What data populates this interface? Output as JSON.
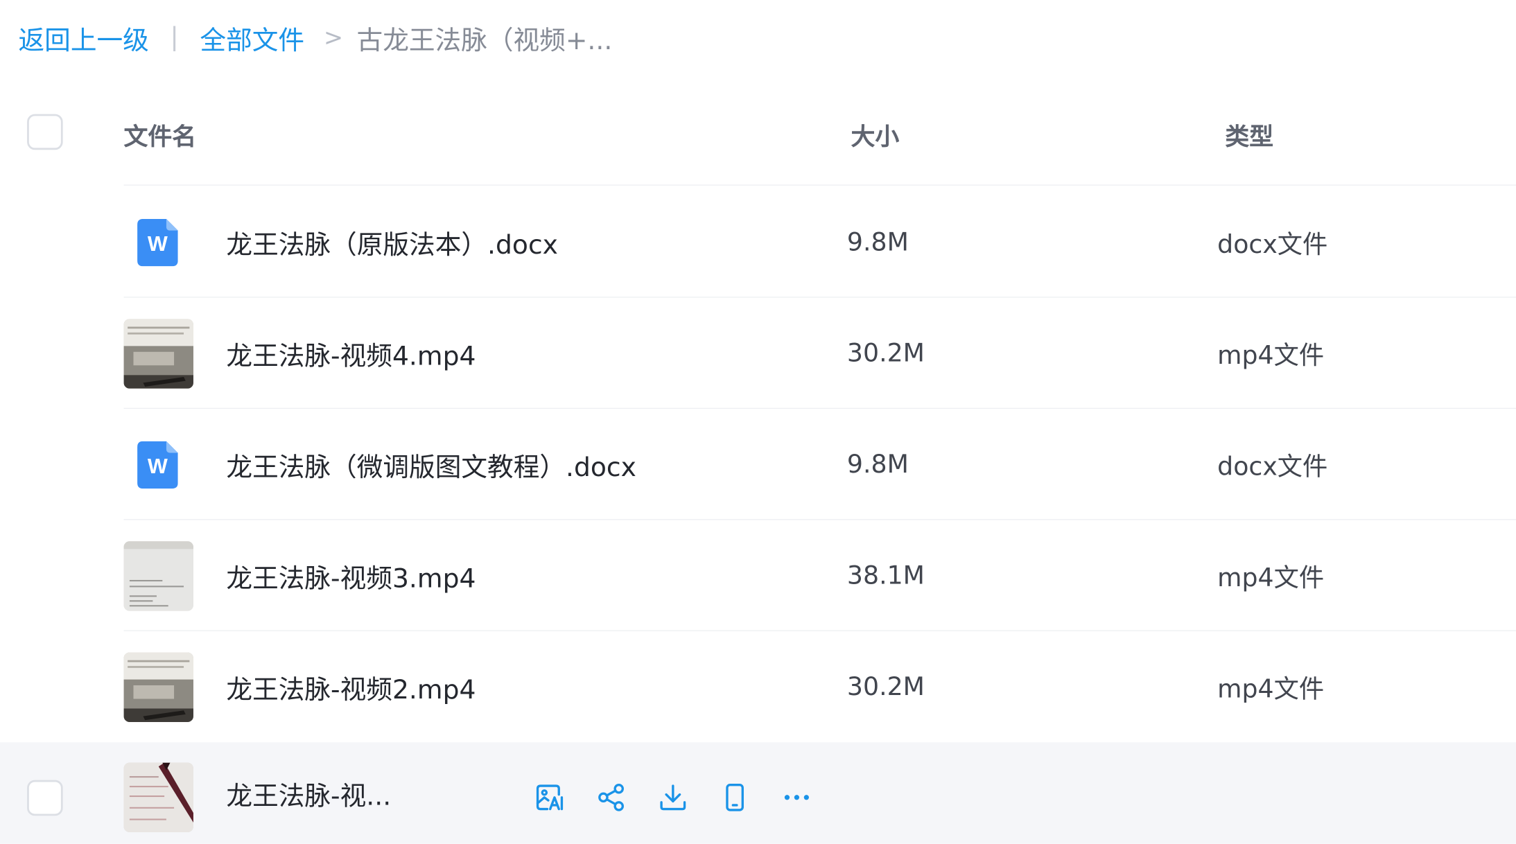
{
  "breadcrumb": {
    "back": "返回上一级",
    "separator": "|",
    "all_files": "全部文件",
    "arrow": ">",
    "current": "古龙王法脉（视频+..."
  },
  "columns": {
    "name": "文件名",
    "size": "大小",
    "type": "类型"
  },
  "files": [
    {
      "name": "龙王法脉（原版法本）.docx",
      "size": "9.8M",
      "type": "docx文件",
      "icon": "word-doc-icon"
    },
    {
      "name": "龙王法脉-视频4.mp4",
      "size": "30.2M",
      "type": "mp4文件",
      "icon": "video-thumbnail"
    },
    {
      "name": "龙王法脉（微调版图文教程）.docx",
      "size": "9.8M",
      "type": "docx文件",
      "icon": "word-doc-icon"
    },
    {
      "name": "龙王法脉-视频3.mp4",
      "size": "38.1M",
      "type": "mp4文件",
      "icon": "video-thumbnail"
    },
    {
      "name": "龙王法脉-视频2.mp4",
      "size": "30.2M",
      "type": "mp4文件",
      "icon": "video-thumbnail"
    },
    {
      "name": "龙王法脉-视...",
      "icon": "video-thumbnail"
    }
  ],
  "row_actions": [
    "image-text-extract-icon",
    "share-icon",
    "download-icon",
    "phone-icon",
    "more-icon"
  ],
  "colors": {
    "accent": "#1a93e8",
    "word_blue": "#3a8ef5",
    "hover_row": "#f5f6f9"
  }
}
